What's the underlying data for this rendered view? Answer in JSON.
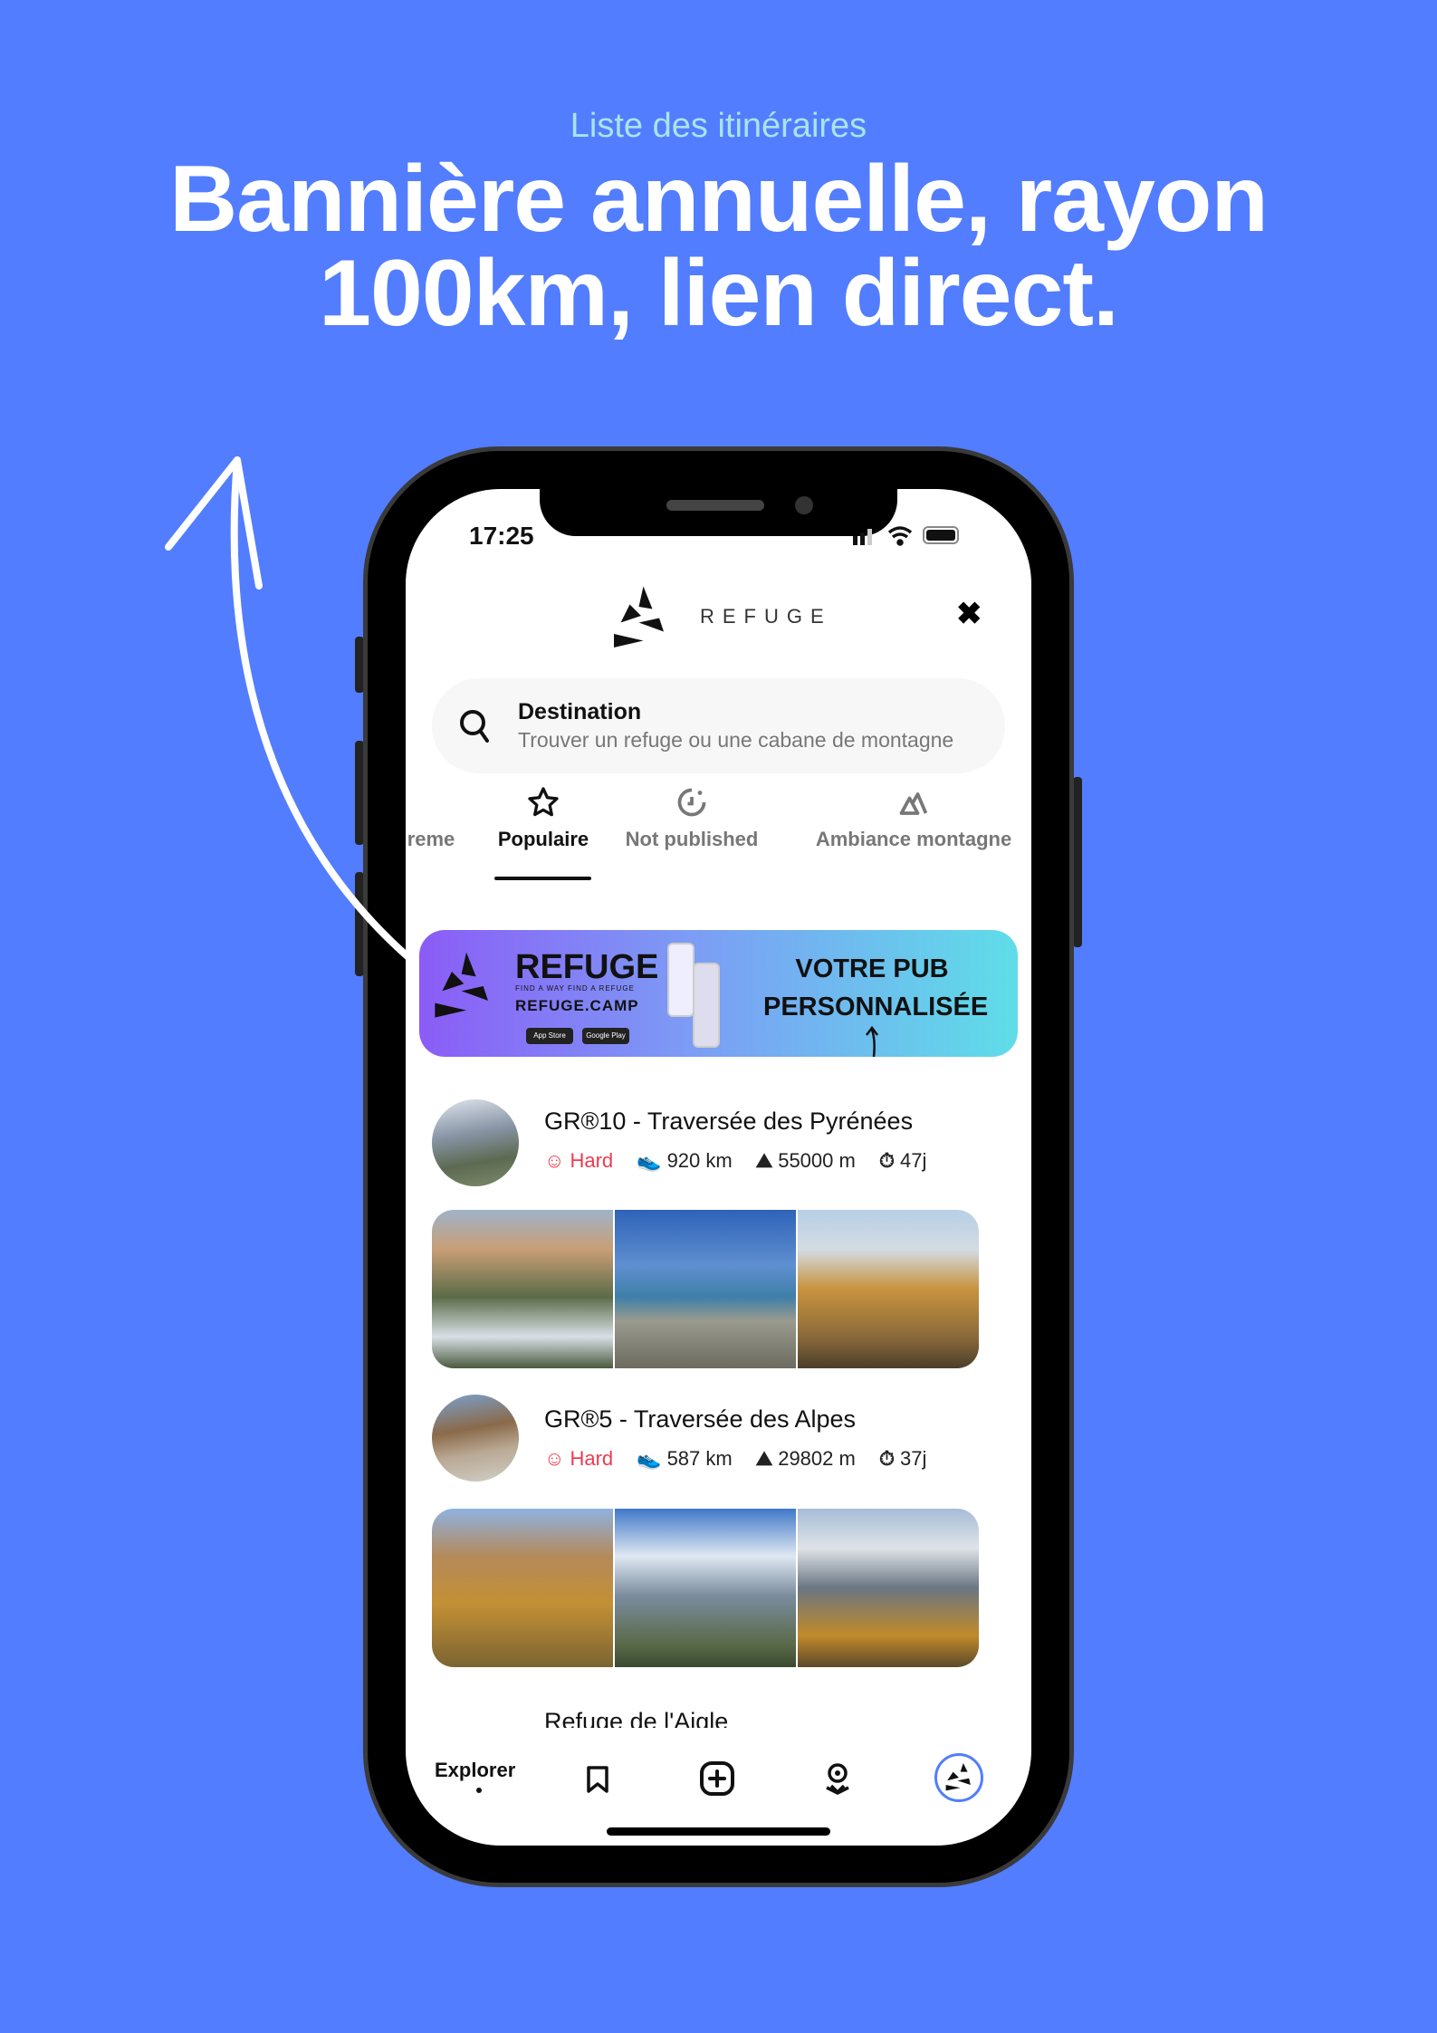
{
  "header": {
    "subtitle": "Liste des itinéraires",
    "title_line1": "Bannière annuelle, rayon",
    "title_line2": "100km, lien direct."
  },
  "colors": {
    "background": "#527dff",
    "subtitle": "#a9e4e6",
    "difficulty_hard": "#f0394f",
    "active_nav": "#527dff"
  },
  "status_bar": {
    "time": "17:25"
  },
  "app": {
    "brand": "REFUGE",
    "close_icon": "close-icon"
  },
  "search": {
    "label": "Destination",
    "placeholder": "Trouver un refuge ou une cabane de montagne"
  },
  "tabs": [
    {
      "label": "reme",
      "icon": ""
    },
    {
      "label": "Populaire",
      "icon": "star-icon",
      "active": true
    },
    {
      "label": "Not published",
      "icon": "clock-icon"
    },
    {
      "label": "Ambiance montagne",
      "icon": "mountain-icon"
    }
  ],
  "banner": {
    "brand": "REFUGE",
    "tagline": "FIND A WAY FIND A REFUGE",
    "site": "REFUGE.CAMP",
    "appstore": "App Store",
    "googleplay": "Google Play",
    "cta_line1": "VOTRE PUB",
    "cta_line2": "PERSONNALISÉE"
  },
  "items": [
    {
      "title": "GR®10 - Traversée des Pyrénées",
      "difficulty": "Hard",
      "distance": "920 km",
      "elevation": "55000 m",
      "duration": "47j"
    },
    {
      "title": "GR®5 - Traversée des Alpes",
      "difficulty": "Hard",
      "distance": "587 km",
      "elevation": "29802 m",
      "duration": "37j"
    },
    {
      "title": "Refuge de l'Aigle"
    }
  ],
  "nav": {
    "explorer": "Explorer",
    "items": [
      "bookmark-icon",
      "add-icon",
      "map-pin-icon",
      "profile-refuge-icon"
    ]
  }
}
